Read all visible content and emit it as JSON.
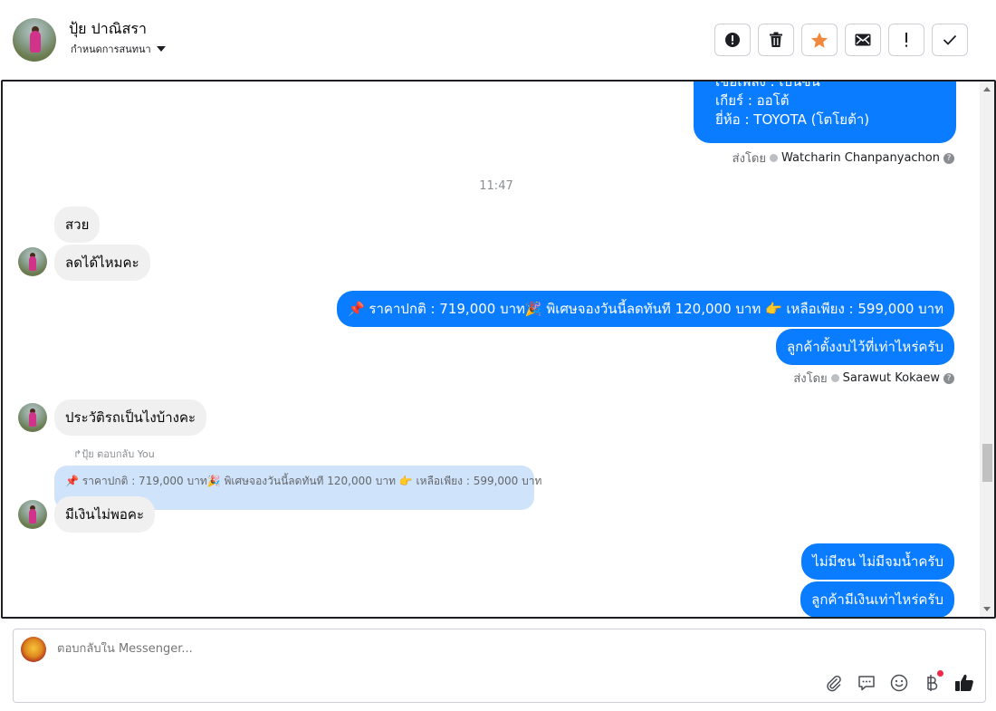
{
  "header": {
    "contact_name": "ปุ้ย ปาณิสรา",
    "assign_label": "กำหนดการสนทนา",
    "actions": [
      {
        "name": "report-icon",
        "label": "Report"
      },
      {
        "name": "trash-icon",
        "label": "Delete"
      },
      {
        "name": "star-icon",
        "label": "Star"
      },
      {
        "name": "envelope-icon",
        "label": "Mark as unread"
      },
      {
        "name": "exclamation-icon",
        "label": "Follow up"
      },
      {
        "name": "checkmark-icon",
        "label": "Mark as done"
      }
    ]
  },
  "messages": {
    "top_bubble_lines": [
      "เชื้อเพลิง : เบนซิน",
      "เกียร์ : ออโต้",
      "ยี่ห้อ : TOYOTA (โตโยต้า)"
    ],
    "sender1_prefix": "ส่งโดย",
    "sender1_name": "Watcharin Chanpanyachon",
    "time": "11:47",
    "in1": "สวย",
    "in2": "ลดได้ไหมคะ",
    "out_price": "📌 ราคาปกติ : 719,000 บาท🎉 พิเศษจองวันนี้ลดทันที 120,000 บาท 👉 เหลือเพียง : 599,000 บาท",
    "out_budget": "ลูกค้าตั้งงบไว้ที่เท่าไหร่ครับ",
    "sender2_prefix": "ส่งโดย",
    "sender2_name": "Sarawut Kokaew",
    "in3": "ประวัติรถเป็นไงบ้างคะ",
    "reply_label": "↱ปุ้ย ตอบกลับ You",
    "quoted_text": "📌 ราคาปกติ : 719,000 บาท🎉 พิเศษจองวันนี้ลดทันที 120,000 บาท 👉 เหลือเพียง : 599,000 บาท",
    "in4": "มีเงินไม่พอคะ",
    "out_no_flood": "ไม่มีชน ไม่มีจมน้ำครับ",
    "out_money": "ลูกค้ามีเงินเท่าไหร่ครับ"
  },
  "composer": {
    "placeholder": "ตอบกลับใน Messenger..."
  },
  "colors": {
    "outgoing_bubble": "#0a7cff",
    "incoming_bubble": "#f0f0f0",
    "quoted_bubble": "#cfe3fb",
    "star": "#f0883e"
  }
}
